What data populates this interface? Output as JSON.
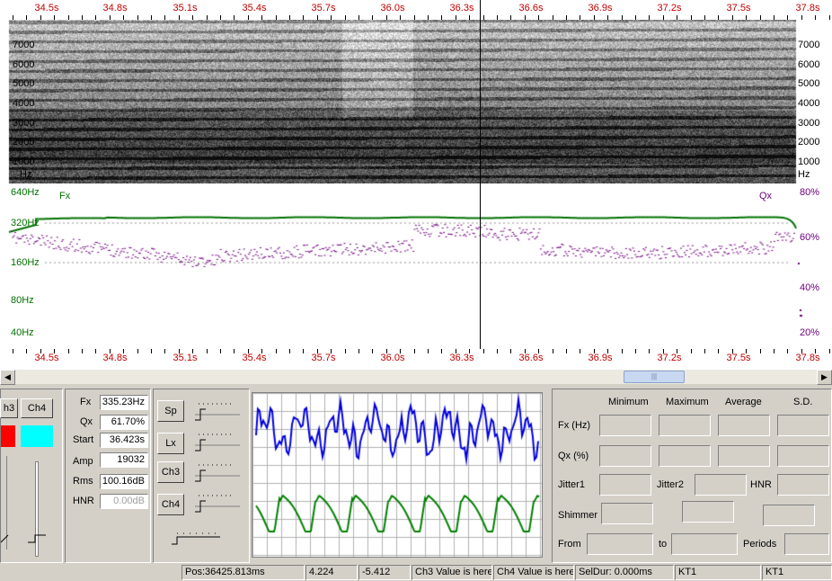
{
  "time_axis": {
    "labels": [
      "34.5s",
      "34.8s",
      "35.1s",
      "35.4s",
      "35.7s",
      "36.0s",
      "36.3s",
      "36.6s",
      "36.9s",
      "37.2s",
      "37.5s",
      "37.8s"
    ]
  },
  "spectrogram": {
    "freq_labels": [
      "7000",
      "6000",
      "5000",
      "4000",
      "3000",
      "2000",
      "1000",
      "Hz"
    ]
  },
  "pitch": {
    "fx_label": "Fx",
    "qx_label": "Qx",
    "hz_labels": [
      "640Hz",
      "320Hz",
      "160Hz",
      "80Hz",
      "40Hz"
    ],
    "pct_labels": [
      "80%",
      "60%",
      "40%",
      "20%"
    ],
    "fx_color": "#007000",
    "qx_color": "#700080"
  },
  "channels": {
    "ch3_tab": "h3",
    "ch4_tab": "Ch4",
    "ch3_color": "#ff0000",
    "ch4_color": "#00ffff"
  },
  "measures": {
    "fx_label": "Fx",
    "fx_value": "335.23Hz",
    "qx_label": "Qx",
    "qx_value": "61.70%",
    "start_label": "Start",
    "start_value": "36.423s",
    "amp_label": "Amp",
    "amp_value": "19032",
    "rms_label": "Rms",
    "rms_value": "100.16dB",
    "hnr_label": "HNR",
    "hnr_value": "0.00dB"
  },
  "mixer": {
    "sp": "Sp",
    "lx": "Lx",
    "ch3": "Ch3",
    "ch4": "Ch4"
  },
  "stats": {
    "col_min": "Minimum",
    "col_max": "Maximum",
    "col_avg": "Average",
    "col_sd": "S.D.",
    "fx_row": "Fx (Hz)",
    "qx_row": "Qx (%)",
    "jitter1": "Jitter1",
    "jitter2": "Jitter2",
    "hnr": "HNR",
    "shimmer": "Shimmer",
    "from": "From",
    "to": "to",
    "periods": "Periods"
  },
  "status": {
    "pos": "Pos:36425.813ms",
    "val1": "4.224",
    "val2": "-5.412",
    "ch3": "Ch3 Value is here",
    "ch4": "Ch4 Value is here",
    "seldur": "SelDur: 0.000ms",
    "kt1a": "KT1",
    "kt1b": "KT1"
  }
}
